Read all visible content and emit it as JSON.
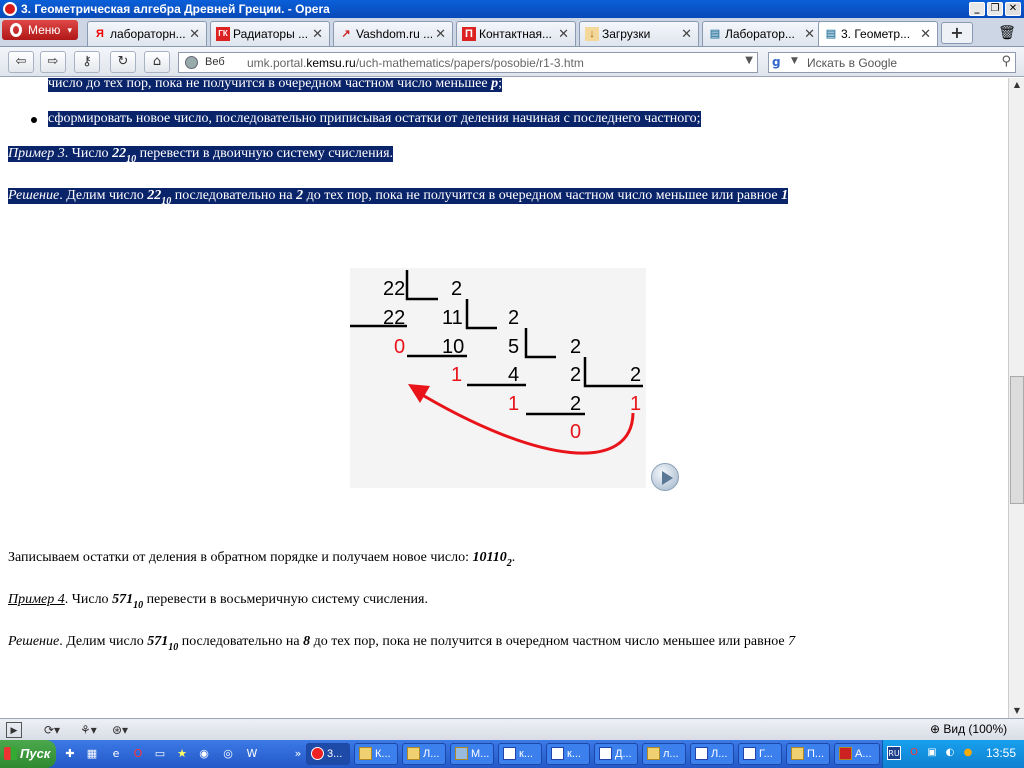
{
  "window": {
    "title": "3. Геометрическая алгебра Древней Греции. - Opera",
    "minimize": "_",
    "restore": "❐",
    "close": "✕"
  },
  "menu_button": {
    "label": "Меню"
  },
  "tabs": [
    {
      "icon": "Я",
      "label": "лабораторн...",
      "close": "✕"
    },
    {
      "icon": "ГК",
      "label": "Радиаторы ...",
      "close": "✕"
    },
    {
      "icon": "↗",
      "label": "Vashdom.ru ...",
      "close": "✕"
    },
    {
      "icon": "П",
      "label": "Контактная...",
      "close": "✕"
    },
    {
      "icon": "↓",
      "label": "Загрузки",
      "close": "✕"
    },
    {
      "icon": "▤",
      "label": "Лаборатор...",
      "close": "✕"
    },
    {
      "icon": "▤",
      "label": "3. Геометр...",
      "close": "✕"
    }
  ],
  "new_tab": "+",
  "trash": "🗑",
  "nav": {
    "back": "⇦",
    "forward": "⇨",
    "keys": "⚷",
    "reload": "↻",
    "home": "⌂",
    "web_label": "Веб",
    "url_prefix": "umk.portal.",
    "url_domain": "kemsu.ru",
    "url_path": "/uch-mathematics/papers/posobie/r1-3.htm",
    "search_placeholder": "Искать в Google"
  },
  "content": {
    "line0": "число до тех пор, пока не получится в очередном частном число меньшее ",
    "line0_p": "p",
    "line0_end": ";",
    "bullet": "сформировать новое число, последовательно приписывая остатки от деления начиная с последнего частного;",
    "ex3_label": "Пример 3",
    "ex3_a": ". Число ",
    "ex3_num": "22",
    "ex3_sub": "10",
    "ex3_b": " перевести в двоичную систему счисления.",
    "sol3_label": "Решение",
    "sol3_a": ". Делим число ",
    "sol3_num": "22",
    "sol3_sub": "10",
    "sol3_b": " последовательно на ",
    "sol3_div": "2",
    "sol3_c": " до тех пор, пока не получится в очередном частном число меньшее или равное ",
    "sol3_lim": "1",
    "result_text": "Записываем остатки от деления в обратном порядке и получаем новое число: ",
    "result_num": "10110",
    "result_sub": "2",
    "result_end": ".",
    "ex4_label": "Пример 4",
    "ex4_a": ". Число ",
    "ex4_num": "571",
    "ex4_sub": "10",
    "ex4_b": " перевести в восьмеричную систему счисления.",
    "sol4_label": "Решение",
    "sol4_a": ". Делим число ",
    "sol4_num": "571",
    "sol4_sub": "10",
    "sol4_b": " последовательно на ",
    "sol4_div": "8",
    "sol4_c": " до тех пор, пока не получится в очередном частном число меньшее или равное ",
    "sol4_lim": "7"
  },
  "diagram": {
    "numbers": [
      "22",
      "2",
      "22",
      "11",
      "2",
      "10",
      "5",
      "2",
      "4",
      "2",
      "2",
      "2"
    ],
    "remainders": [
      "0",
      "1",
      "1",
      "0",
      "1"
    ],
    "colors": {
      "digits": "#000000",
      "remainders": "#e8141a",
      "arrow": "#e8141a"
    }
  },
  "status": {
    "zoom": "Вид (100%)"
  },
  "taskbar": {
    "start": "Пуск",
    "buttons": [
      "3...",
      "К...",
      "Л...",
      "М...",
      "к...",
      "к...",
      "Д...",
      "л...",
      "Л...",
      "Г...",
      "П...",
      "А..."
    ],
    "tray_lang": "RU",
    "clock": "13:55"
  }
}
